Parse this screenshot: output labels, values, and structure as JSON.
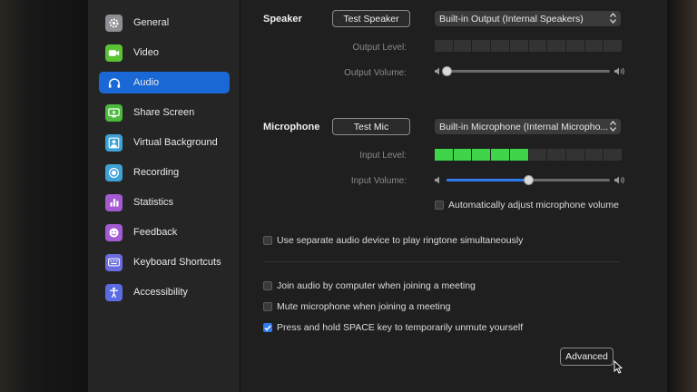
{
  "sidebar": {
    "items": [
      {
        "label": "General",
        "icon": "gear-icon",
        "color": "#8e8e93"
      },
      {
        "label": "Video",
        "icon": "video-camera-icon",
        "color": "#5bc236"
      },
      {
        "label": "Audio",
        "icon": "headphones-icon",
        "color": "#1a68d6",
        "active": true
      },
      {
        "label": "Share Screen",
        "icon": "share-screen-icon",
        "color": "#4cbb3d"
      },
      {
        "label": "Virtual Background",
        "icon": "person-background-icon",
        "color": "#3fa2d6"
      },
      {
        "label": "Recording",
        "icon": "record-icon",
        "color": "#3fa2d6"
      },
      {
        "label": "Statistics",
        "icon": "bar-chart-icon",
        "color": "#a45ad1"
      },
      {
        "label": "Feedback",
        "icon": "smiley-icon",
        "color": "#a45ad1"
      },
      {
        "label": "Keyboard Shortcuts",
        "icon": "keyboard-icon",
        "color": "#6a6ce0"
      },
      {
        "label": "Accessibility",
        "icon": "accessibility-icon",
        "color": "#5b6be0"
      }
    ]
  },
  "speaker": {
    "heading": "Speaker",
    "test_button": "Test Speaker",
    "device": "Built-in Output (Internal Speakers)",
    "output_level_label": "Output Level:",
    "output_level": 0,
    "output_volume_label": "Output Volume:",
    "output_volume": 0.0
  },
  "microphone": {
    "heading": "Microphone",
    "test_button": "Test Mic",
    "device": "Built-in Microphone (Internal Micropho...",
    "input_level_label": "Input Level:",
    "input_level_segments_on": 5,
    "input_volume_label": "Input Volume:",
    "input_volume": 0.5,
    "auto_adjust_label": "Automatically adjust microphone volume",
    "auto_adjust_checked": false
  },
  "options": {
    "separate_device_label": "Use separate audio device to play ringtone simultaneously",
    "separate_device_checked": false,
    "join_audio_label": "Join audio by computer when joining a meeting",
    "join_audio_checked": false,
    "mute_mic_label": "Mute microphone when joining a meeting",
    "mute_mic_checked": false,
    "space_unmute_label": "Press and hold SPACE key to temporarily unmute yourself",
    "space_unmute_checked": true
  },
  "advanced_button": "Advanced",
  "colors": {
    "accent": "#1a68d6",
    "slider_fill": "#2f7bea",
    "meter_on": "#3fd44a"
  }
}
